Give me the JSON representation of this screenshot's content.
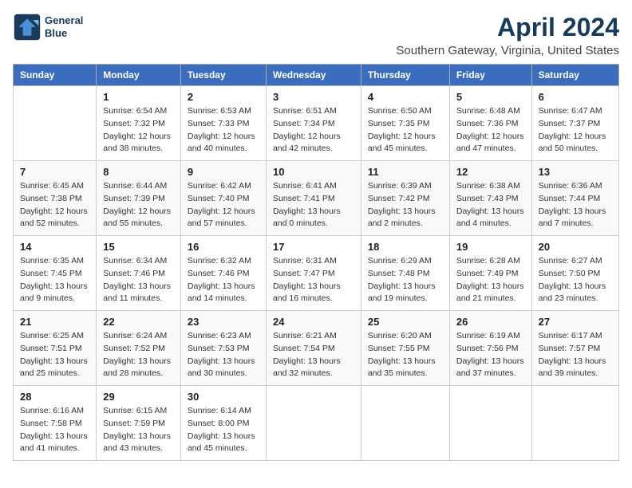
{
  "logo": {
    "line1": "General",
    "line2": "Blue"
  },
  "title": "April 2024",
  "subtitle": "Southern Gateway, Virginia, United States",
  "headers": [
    "Sunday",
    "Monday",
    "Tuesday",
    "Wednesday",
    "Thursday",
    "Friday",
    "Saturday"
  ],
  "weeks": [
    [
      {
        "day": "",
        "sunrise": "",
        "sunset": "",
        "daylight": ""
      },
      {
        "day": "1",
        "sunrise": "Sunrise: 6:54 AM",
        "sunset": "Sunset: 7:32 PM",
        "daylight": "Daylight: 12 hours and 38 minutes."
      },
      {
        "day": "2",
        "sunrise": "Sunrise: 6:53 AM",
        "sunset": "Sunset: 7:33 PM",
        "daylight": "Daylight: 12 hours and 40 minutes."
      },
      {
        "day": "3",
        "sunrise": "Sunrise: 6:51 AM",
        "sunset": "Sunset: 7:34 PM",
        "daylight": "Daylight: 12 hours and 42 minutes."
      },
      {
        "day": "4",
        "sunrise": "Sunrise: 6:50 AM",
        "sunset": "Sunset: 7:35 PM",
        "daylight": "Daylight: 12 hours and 45 minutes."
      },
      {
        "day": "5",
        "sunrise": "Sunrise: 6:48 AM",
        "sunset": "Sunset: 7:36 PM",
        "daylight": "Daylight: 12 hours and 47 minutes."
      },
      {
        "day": "6",
        "sunrise": "Sunrise: 6:47 AM",
        "sunset": "Sunset: 7:37 PM",
        "daylight": "Daylight: 12 hours and 50 minutes."
      }
    ],
    [
      {
        "day": "7",
        "sunrise": "Sunrise: 6:45 AM",
        "sunset": "Sunset: 7:38 PM",
        "daylight": "Daylight: 12 hours and 52 minutes."
      },
      {
        "day": "8",
        "sunrise": "Sunrise: 6:44 AM",
        "sunset": "Sunset: 7:39 PM",
        "daylight": "Daylight: 12 hours and 55 minutes."
      },
      {
        "day": "9",
        "sunrise": "Sunrise: 6:42 AM",
        "sunset": "Sunset: 7:40 PM",
        "daylight": "Daylight: 12 hours and 57 minutes."
      },
      {
        "day": "10",
        "sunrise": "Sunrise: 6:41 AM",
        "sunset": "Sunset: 7:41 PM",
        "daylight": "Daylight: 13 hours and 0 minutes."
      },
      {
        "day": "11",
        "sunrise": "Sunrise: 6:39 AM",
        "sunset": "Sunset: 7:42 PM",
        "daylight": "Daylight: 13 hours and 2 minutes."
      },
      {
        "day": "12",
        "sunrise": "Sunrise: 6:38 AM",
        "sunset": "Sunset: 7:43 PM",
        "daylight": "Daylight: 13 hours and 4 minutes."
      },
      {
        "day": "13",
        "sunrise": "Sunrise: 6:36 AM",
        "sunset": "Sunset: 7:44 PM",
        "daylight": "Daylight: 13 hours and 7 minutes."
      }
    ],
    [
      {
        "day": "14",
        "sunrise": "Sunrise: 6:35 AM",
        "sunset": "Sunset: 7:45 PM",
        "daylight": "Daylight: 13 hours and 9 minutes."
      },
      {
        "day": "15",
        "sunrise": "Sunrise: 6:34 AM",
        "sunset": "Sunset: 7:46 PM",
        "daylight": "Daylight: 13 hours and 11 minutes."
      },
      {
        "day": "16",
        "sunrise": "Sunrise: 6:32 AM",
        "sunset": "Sunset: 7:46 PM",
        "daylight": "Daylight: 13 hours and 14 minutes."
      },
      {
        "day": "17",
        "sunrise": "Sunrise: 6:31 AM",
        "sunset": "Sunset: 7:47 PM",
        "daylight": "Daylight: 13 hours and 16 minutes."
      },
      {
        "day": "18",
        "sunrise": "Sunrise: 6:29 AM",
        "sunset": "Sunset: 7:48 PM",
        "daylight": "Daylight: 13 hours and 19 minutes."
      },
      {
        "day": "19",
        "sunrise": "Sunrise: 6:28 AM",
        "sunset": "Sunset: 7:49 PM",
        "daylight": "Daylight: 13 hours and 21 minutes."
      },
      {
        "day": "20",
        "sunrise": "Sunrise: 6:27 AM",
        "sunset": "Sunset: 7:50 PM",
        "daylight": "Daylight: 13 hours and 23 minutes."
      }
    ],
    [
      {
        "day": "21",
        "sunrise": "Sunrise: 6:25 AM",
        "sunset": "Sunset: 7:51 PM",
        "daylight": "Daylight: 13 hours and 25 minutes."
      },
      {
        "day": "22",
        "sunrise": "Sunrise: 6:24 AM",
        "sunset": "Sunset: 7:52 PM",
        "daylight": "Daylight: 13 hours and 28 minutes."
      },
      {
        "day": "23",
        "sunrise": "Sunrise: 6:23 AM",
        "sunset": "Sunset: 7:53 PM",
        "daylight": "Daylight: 13 hours and 30 minutes."
      },
      {
        "day": "24",
        "sunrise": "Sunrise: 6:21 AM",
        "sunset": "Sunset: 7:54 PM",
        "daylight": "Daylight: 13 hours and 32 minutes."
      },
      {
        "day": "25",
        "sunrise": "Sunrise: 6:20 AM",
        "sunset": "Sunset: 7:55 PM",
        "daylight": "Daylight: 13 hours and 35 minutes."
      },
      {
        "day": "26",
        "sunrise": "Sunrise: 6:19 AM",
        "sunset": "Sunset: 7:56 PM",
        "daylight": "Daylight: 13 hours and 37 minutes."
      },
      {
        "day": "27",
        "sunrise": "Sunrise: 6:17 AM",
        "sunset": "Sunset: 7:57 PM",
        "daylight": "Daylight: 13 hours and 39 minutes."
      }
    ],
    [
      {
        "day": "28",
        "sunrise": "Sunrise: 6:16 AM",
        "sunset": "Sunset: 7:58 PM",
        "daylight": "Daylight: 13 hours and 41 minutes."
      },
      {
        "day": "29",
        "sunrise": "Sunrise: 6:15 AM",
        "sunset": "Sunset: 7:59 PM",
        "daylight": "Daylight: 13 hours and 43 minutes."
      },
      {
        "day": "30",
        "sunrise": "Sunrise: 6:14 AM",
        "sunset": "Sunset: 8:00 PM",
        "daylight": "Daylight: 13 hours and 45 minutes."
      },
      {
        "day": "",
        "sunrise": "",
        "sunset": "",
        "daylight": ""
      },
      {
        "day": "",
        "sunrise": "",
        "sunset": "",
        "daylight": ""
      },
      {
        "day": "",
        "sunrise": "",
        "sunset": "",
        "daylight": ""
      },
      {
        "day": "",
        "sunrise": "",
        "sunset": "",
        "daylight": ""
      }
    ]
  ]
}
